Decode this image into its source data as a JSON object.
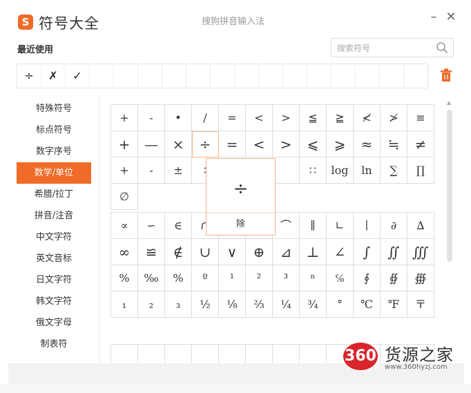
{
  "window": {
    "logo_char": "S",
    "title": "符号大全",
    "ime_name": "搜狗拼音输入法",
    "minimize_label": "–",
    "close_label": "✕"
  },
  "recent": {
    "label": "最近使用",
    "items": [
      "÷",
      "✗",
      "✓",
      "",
      "",
      "",
      "",
      "",
      "",
      "",
      "",
      "",
      "",
      "",
      "",
      "",
      ""
    ]
  },
  "search": {
    "placeholder": "搜索符号",
    "value": ""
  },
  "sidebar": {
    "active_index": 3,
    "items": [
      "特殊符号",
      "标点符号",
      "数字序号",
      "数学/单位",
      "希腊/拉丁",
      "拼音/注音",
      "中文字符",
      "英文音标",
      "日文字符",
      "韩文字符",
      "俄文字母",
      "制表符"
    ]
  },
  "grid1": [
    "+",
    "-",
    "•",
    "/",
    "=",
    "<",
    ">",
    "≦",
    "≧",
    "≮",
    "≯",
    "≡",
    "+",
    "—",
    "×",
    "÷",
    "=",
    "<",
    ">",
    "⩽",
    "⩾",
    "≈",
    "≒",
    "≠",
    "+",
    "-",
    "±",
    "∶",
    "",
    "",
    "",
    "∷",
    "log",
    "ln",
    "∑",
    "∏",
    "∅"
  ],
  "grid2": [
    "∝",
    "∽",
    "∈",
    "∩",
    "",
    "",
    "⌒",
    "∥",
    "∟",
    "∣",
    "∂",
    "∆",
    "∞",
    "≌",
    "∉",
    "∪",
    "∨",
    "⊕",
    "⊿",
    "⊥",
    "∠",
    "∫",
    "∬",
    "∭",
    "%",
    "‰",
    "%",
    "º",
    "¹",
    "²",
    "³",
    "ⁿ",
    "℅",
    "∮",
    "∯",
    "∰",
    "₁",
    "₂",
    "₃",
    "½",
    "⅛",
    "⅔",
    "¼",
    "¾",
    "°",
    "℃",
    "℉",
    "〒"
  ],
  "popup": {
    "symbol": "÷",
    "name": "除"
  },
  "watermark": {
    "badge": "360",
    "text": "货源之家",
    "url": "www.360hyzj.com"
  },
  "colors": {
    "accent": "#f06a28",
    "popup_border": "#f5b58a",
    "watermark_red": "#d8262c"
  }
}
